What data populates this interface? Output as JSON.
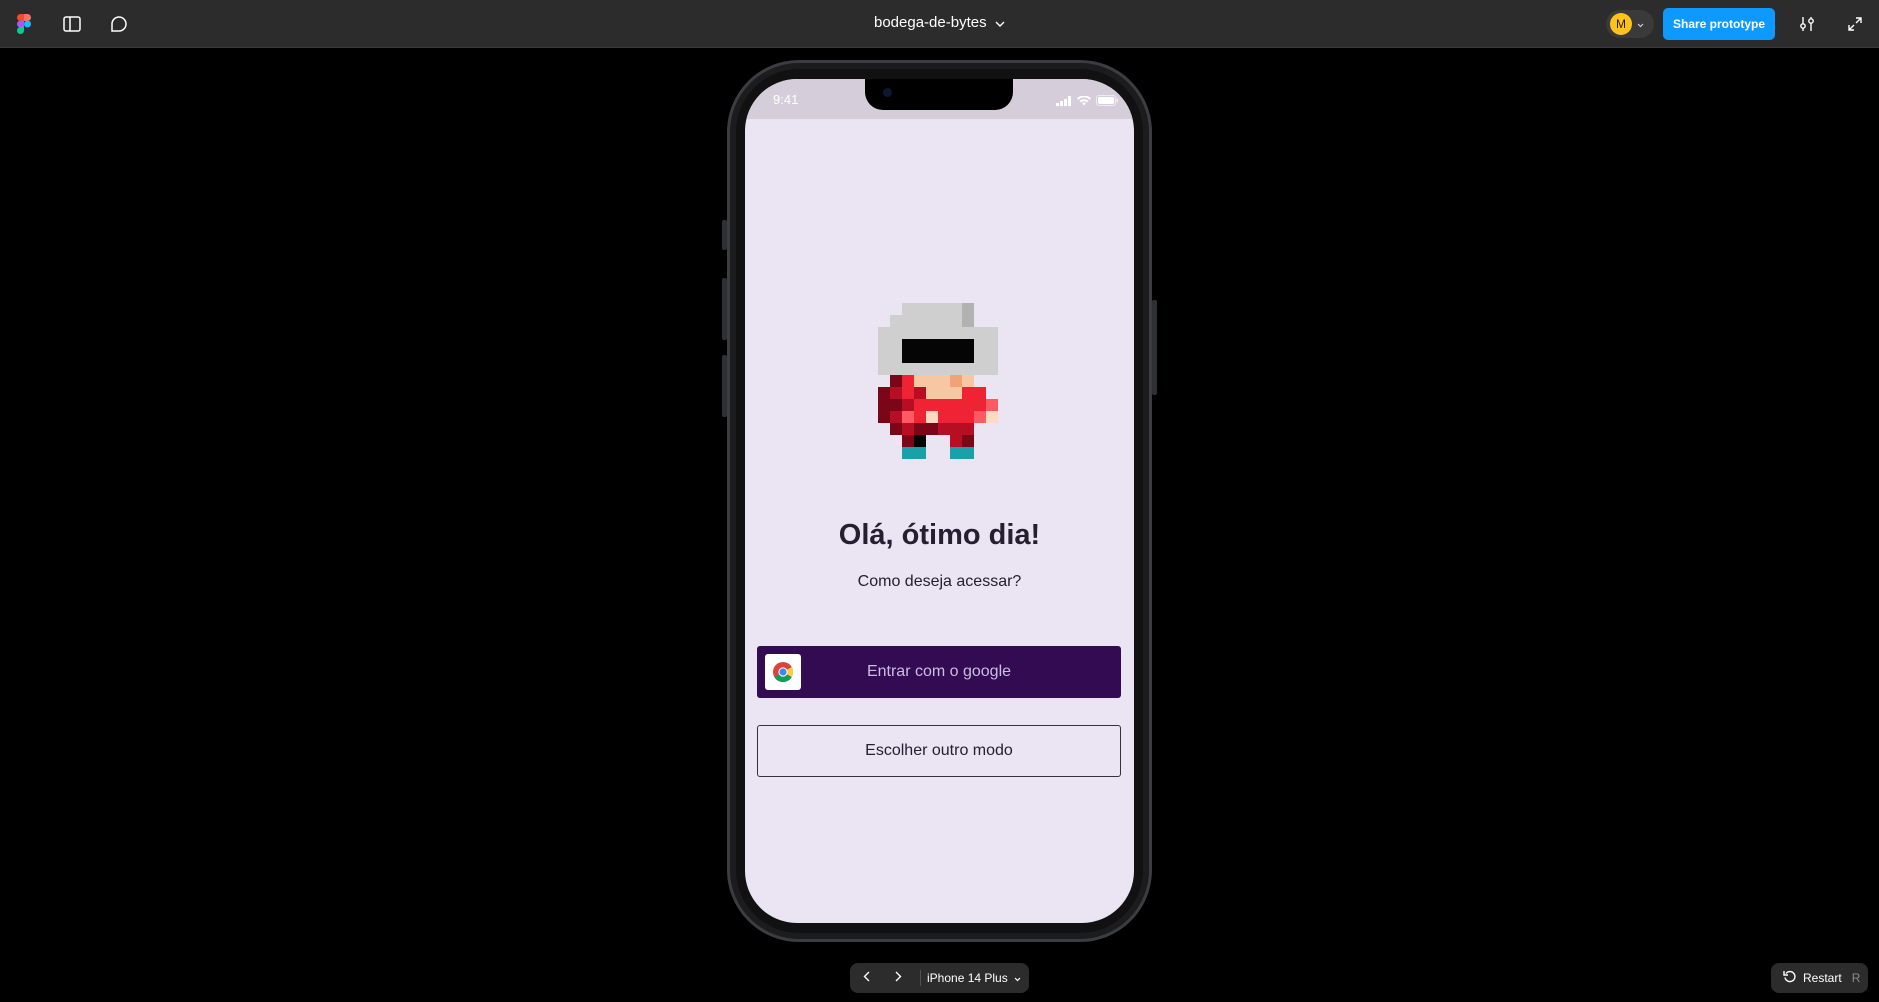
{
  "topbar": {
    "doc_title": "bodega-de-bytes",
    "avatar_initial": "M",
    "share_label": "Share prototype"
  },
  "phone": {
    "status_time": "9:41",
    "greeting": "Olá, ótimo dia!",
    "subtitle": "Como deseja acessar?",
    "google_button_label": "Entrar com o google",
    "other_button_label": "Escolher outro modo",
    "screen_color": "#ebe4f3",
    "primary_color": "#330b52"
  },
  "bottom": {
    "device_name": "iPhone 14 Plus",
    "restart_label": "Restart",
    "restart_shortcut": "R"
  },
  "icons": [
    "figma-logo-icon",
    "sidebar-panel-icon",
    "comment-icon",
    "chevron-down-icon",
    "settings-sliders-icon",
    "expand-icon",
    "chevron-left-icon",
    "chevron-right-icon",
    "restart-icon",
    "google-chrome-icon",
    "signal-icon",
    "wifi-icon",
    "battery-icon"
  ]
}
